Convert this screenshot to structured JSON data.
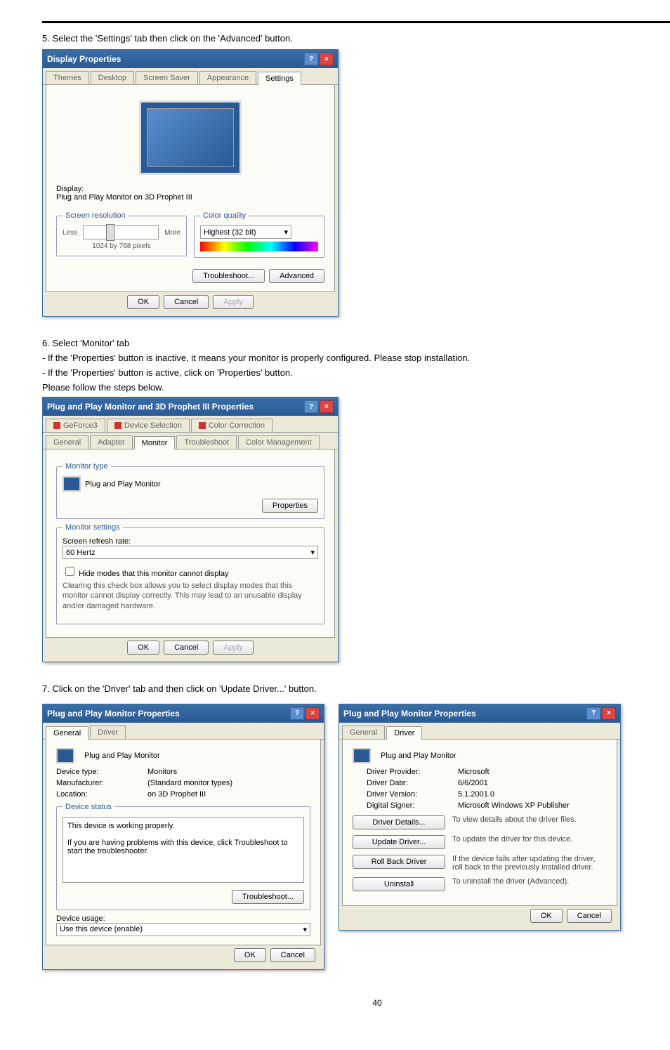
{
  "page_number": "40",
  "step5": "5. Select the 'Settings' tab then click on the 'Advanced' button.",
  "dlg1": {
    "title": "Display Properties",
    "tabs": [
      "Themes",
      "Desktop",
      "Screen Saver",
      "Appearance",
      "Settings"
    ],
    "display_label": "Display:",
    "display_value": "Plug and Play Monitor on 3D Prophet III",
    "res_group": "Screen resolution",
    "less": "Less",
    "more": "More",
    "res_value": "1024 by 768 pixels",
    "color_group": "Color quality",
    "color_value": "Highest (32 bit)",
    "troubleshoot": "Troubleshoot...",
    "advanced": "Advanced",
    "ok": "OK",
    "cancel": "Cancel",
    "apply": "Apply"
  },
  "step6_a": "6. Select 'Monitor' tab",
  "step6_b": "- If the 'Properties' button is inactive, it means your monitor is properly configured. Please stop installation.",
  "step6_c": "- If the 'Properties' button is active, click on 'Properties' button.",
  "step6_d": "Please follow the steps below.",
  "dlg2": {
    "title": "Plug and Play Monitor and 3D Prophet III Properties",
    "toptabs": [
      "GeForce3",
      "Device Selection",
      "Color Correction"
    ],
    "bottabs": [
      "General",
      "Adapter",
      "Monitor",
      "Troubleshoot",
      "Color Management"
    ],
    "montype_grp": "Monitor type",
    "montype_val": "Plug and Play Monitor",
    "properties": "Properties",
    "monset_grp": "Monitor settings",
    "refresh_label": "Screen refresh rate:",
    "refresh_val": "60 Hertz",
    "hide_check": "Hide modes that this monitor cannot display",
    "hide_desc": "Clearing this check box allows you to select display modes that this monitor cannot display correctly. This may lead to an unusable display and/or damaged hardware.",
    "ok": "OK",
    "cancel": "Cancel",
    "apply": "Apply"
  },
  "step7": "7. Click on the 'Driver' tab and then click on 'Update Driver...' button.",
  "dlg3": {
    "title": "Plug and Play Monitor Properties",
    "tabs": [
      "General",
      "Driver"
    ],
    "header": "Plug and Play Monitor",
    "devtype_l": "Device type:",
    "devtype_v": "Monitors",
    "manu_l": "Manufacturer:",
    "manu_v": "(Standard monitor types)",
    "loc_l": "Location:",
    "loc_v": "on 3D Prophet III",
    "status_grp": "Device status",
    "status_txt": "This device is working properly.",
    "status_help": "If you are having problems with this device, click Troubleshoot to start the troubleshooter.",
    "troubleshoot": "Troubleshoot...",
    "usage_l": "Device usage:",
    "usage_v": "Use this device (enable)",
    "ok": "OK",
    "cancel": "Cancel"
  },
  "dlg4": {
    "title": "Plug and Play Monitor Properties",
    "tabs": [
      "General",
      "Driver"
    ],
    "header": "Plug and Play Monitor",
    "prov_l": "Driver Provider:",
    "prov_v": "Microsoft",
    "date_l": "Driver Date:",
    "date_v": "6/6/2001",
    "ver_l": "Driver Version:",
    "ver_v": "5.1.2001.0",
    "sig_l": "Digital Signer:",
    "sig_v": "Microsoft Windows XP Publisher",
    "details_btn": "Driver Details...",
    "details_desc": "To view details about the driver files.",
    "update_btn": "Update Driver...",
    "update_desc": "To update the driver for this device.",
    "rollback_btn": "Roll Back Driver",
    "rollback_desc": "If the device fails after updating the driver, roll back to the previously installed driver.",
    "uninstall_btn": "Uninstall",
    "uninstall_desc": "To uninstall the driver (Advanced).",
    "ok": "OK",
    "cancel": "Cancel"
  }
}
